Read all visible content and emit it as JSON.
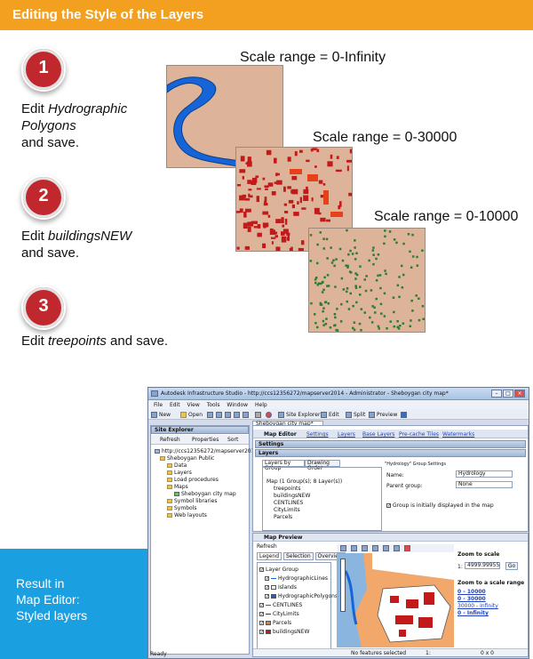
{
  "header": {
    "title": "Editing the Style of the Layers",
    "color": "#f3a021"
  },
  "steps": [
    {
      "number": "1",
      "prefix": "Edit ",
      "layer": "Hydrographic Polygons",
      "suffix": "and save."
    },
    {
      "number": "2",
      "prefix": "Edit ",
      "layer": "buildingsNEW",
      "suffix": "and save."
    },
    {
      "number": "3",
      "prefix": "Edit ",
      "layer": "treepoints",
      "suffix": " and save."
    }
  ],
  "scale_labels": [
    "Scale range = 0-Infinity",
    "Scale range = 0-30000",
    "Scale range = 0-10000"
  ],
  "result": {
    "line1": "Result in",
    "line2": "Map Editor:",
    "line3": "Styled layers"
  },
  "colors": {
    "step_circle": "#c0282e",
    "result_bg": "#1aa0e0",
    "map_bg": "#ddb49a",
    "water": "#1565d8",
    "buildings": "#c21a1a",
    "trees": "#2e7d32"
  },
  "app": {
    "title": "Autodesk Infrastructure Studio - http://ccs12356272/mapserver2014 - Administrator - Sheboygan city map*",
    "menu": [
      "File",
      "Edit",
      "View",
      "Tools",
      "Window",
      "Help"
    ],
    "toolbar": {
      "new": "New",
      "open": "Open",
      "site_explorer": "Site Explorer",
      "edit": "Edit",
      "split": "Split",
      "preview": "Preview"
    },
    "site_explorer": {
      "title": "Site Explorer",
      "refresh": "Refresh",
      "properties": "Properties",
      "sort": "Sort",
      "tree": [
        "http://ccs12356272/mapserver2014...",
        "Sheboygan Public",
        "Data",
        "Layers",
        "Load procedures",
        "Maps",
        "Sheboygan city map",
        "Symbol libraries",
        "Symbols",
        "Web layouts"
      ]
    },
    "doc_tab": "Sheboygan city map*",
    "map_editor": {
      "title": "Map Editor",
      "tabs": [
        "Settings",
        "Layers",
        "Base Layers",
        "Pre-cache Tiles",
        "Watermarks"
      ],
      "settings_label": "Settings",
      "layers_label": "Layers",
      "sub_tabs": [
        "Layers by Group",
        "Drawing Order"
      ],
      "tree_root": "Map (1 Group(s); 8 Layer(s))",
      "layers": [
        "treepoints",
        "buildingsNEW",
        "CENTLINES",
        "CityLimits",
        "Parcels"
      ],
      "group_settings": "\"Hydrology\" Group Settings",
      "name_label": "Name:",
      "name_value": "Hydrology",
      "parent_label": "Parent group:",
      "parent_value": "None",
      "display_check": "Group is initially displayed in the map"
    },
    "map_preview": {
      "title": "Map Preview",
      "refresh": "Refresh",
      "tabs": [
        "Legend",
        "Selection",
        "Overview"
      ],
      "legend": [
        "Layer Group",
        "HydrographicLines",
        "Islands",
        "HydrographicPolygons",
        "CENTLINES",
        "CityLimits",
        "Parcels",
        "buildingsNEW"
      ],
      "zoom_to_scale": "Zoom to scale",
      "scale_prefix": "1:",
      "scale_value": "4999.99955",
      "go": "Go",
      "zoom_range": "Zoom to a scale range",
      "ranges": [
        "0 - 10000",
        "0 - 30000",
        "30000 - Infinity",
        "0 - Infinity"
      ],
      "status_selected": "No features selected",
      "status_scale": "1:",
      "status_size": "0 x 0"
    },
    "status": "Ready"
  }
}
